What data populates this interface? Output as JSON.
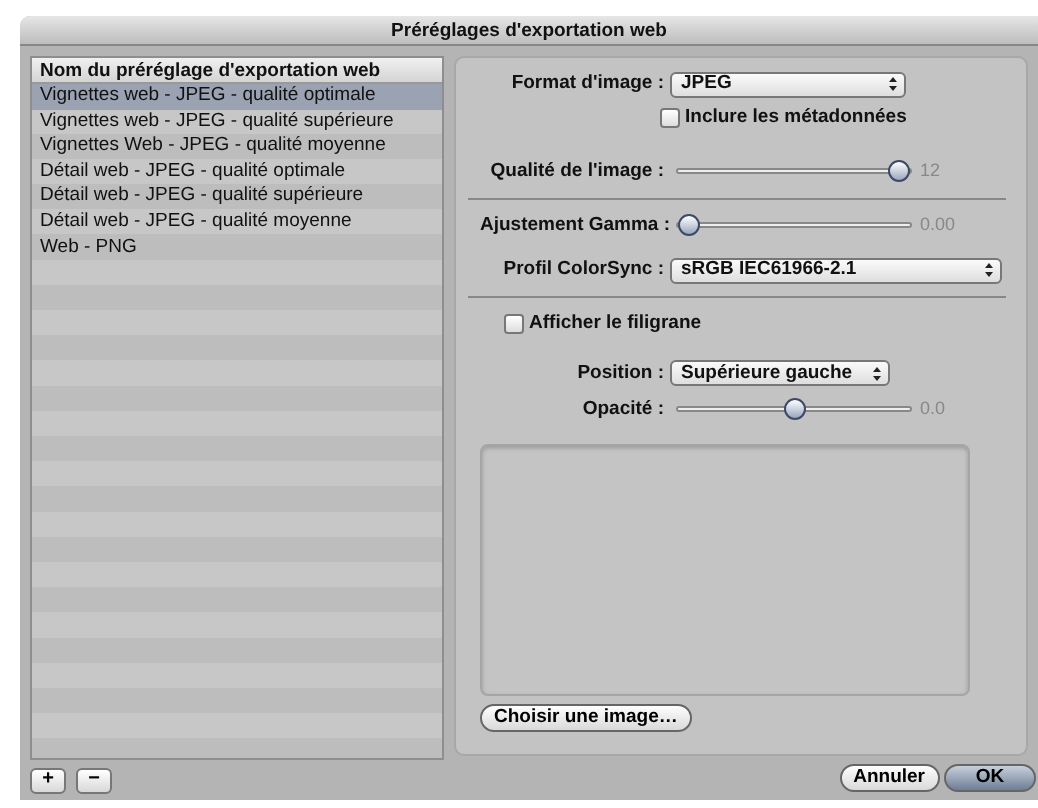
{
  "window": {
    "title": "Préréglages d'exportation web"
  },
  "preset_list": {
    "header": "Nom du préréglage d'exportation web",
    "items": [
      {
        "label": "Vignettes web - JPEG - qualité optimale",
        "selected": true
      },
      {
        "label": "Vignettes web - JPEG - qualité supérieure",
        "selected": false
      },
      {
        "label": "Vignettes Web - JPEG - qualité moyenne",
        "selected": false
      },
      {
        "label": "Détail web - JPEG - qualité optimale",
        "selected": false
      },
      {
        "label": "Détail web - JPEG - qualité supérieure",
        "selected": false
      },
      {
        "label": "Détail web - JPEG - qualité moyenne",
        "selected": false
      },
      {
        "label": "Web - PNG",
        "selected": false
      }
    ]
  },
  "list_buttons": [
    "+",
    "−"
  ],
  "settings": {
    "format": {
      "label": "Format d'image :",
      "value": "JPEG"
    },
    "include_metadata": {
      "label": "Inclure les métadonnées",
      "checked": false
    },
    "quality": {
      "label": "Qualité de l'image :",
      "level": 1,
      "reading": "12"
    },
    "gamma": {
      "label": "Ajustement Gamma :",
      "level": 0,
      "reading": "0.00"
    },
    "profile": {
      "label": "Profil ColorSync :",
      "value": "sRGB IEC61966-2.1"
    },
    "show_watermark": {
      "label": "Afficher le filigrane",
      "checked": false
    },
    "position": {
      "label": "Position :",
      "value": "Supérieure gauche"
    },
    "opacity": {
      "label": "Opacité :",
      "level": 0.5,
      "reading": "0.0"
    },
    "choose_button": "Choisir une image…"
  },
  "buttons": [
    {
      "label": "Annuler",
      "default": false
    },
    {
      "label": "OK",
      "default": true
    }
  ]
}
